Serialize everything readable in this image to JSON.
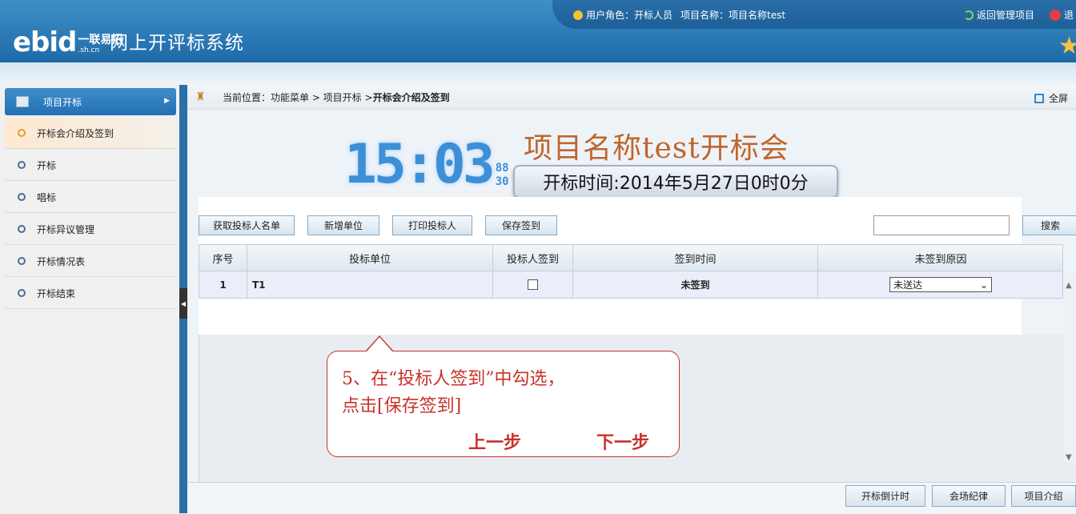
{
  "header": {
    "logo_main": "ebid",
    "logo_sub_top": "一联易招",
    "logo_sub_bottom": ".sh.cn",
    "system_title": "网上开评标系统",
    "user_role_label": "用户角色：开标人员",
    "project_name_label": "项目名称：项目名称test",
    "back_label": "返回管理项目",
    "logout_label": "退"
  },
  "sidebar": {
    "group_label": "项目开标",
    "items": [
      {
        "label": "开标会介绍及签到",
        "active": true
      },
      {
        "label": "开标",
        "active": false
      },
      {
        "label": "唱标",
        "active": false
      },
      {
        "label": "开标异议管理",
        "active": false
      },
      {
        "label": "开标情况表",
        "active": false
      },
      {
        "label": "开标结束",
        "active": false
      }
    ]
  },
  "breadcrumb": {
    "prefix": "当前位置：功能菜单 > 项目开标 > ",
    "current": "开标会介绍及签到",
    "fullscreen_label": "全屏"
  },
  "meeting": {
    "clock_time": "15:03",
    "clock_sec_top": "88",
    "clock_sec_bottom": "30",
    "title": "项目名称test开标会",
    "open_time": "开标时间:2014年5月27日0时0分"
  },
  "toolbar": {
    "get_bidders": "获取投标人名单",
    "add_unit": "新增单位",
    "print_bidders": "打印投标人",
    "save_signin": "保存签到",
    "search_value": "",
    "search_label": "搜索"
  },
  "table": {
    "headers": [
      "序号",
      "投标单位",
      "投标人签到",
      "签到时间",
      "未签到原因"
    ],
    "rows": [
      {
        "index": "1",
        "unit": "T1",
        "signed": false,
        "sign_time": "未签到",
        "reason": "未送达"
      }
    ]
  },
  "callout": {
    "line1": "5、在“投标人签到”中勾选，",
    "line2": "点击[保存签到]",
    "prev": "上一步",
    "next": "下一步"
  },
  "footer": {
    "countdown": "开标倒计时",
    "discipline": "会场纪律",
    "intro": "项目介绍"
  }
}
